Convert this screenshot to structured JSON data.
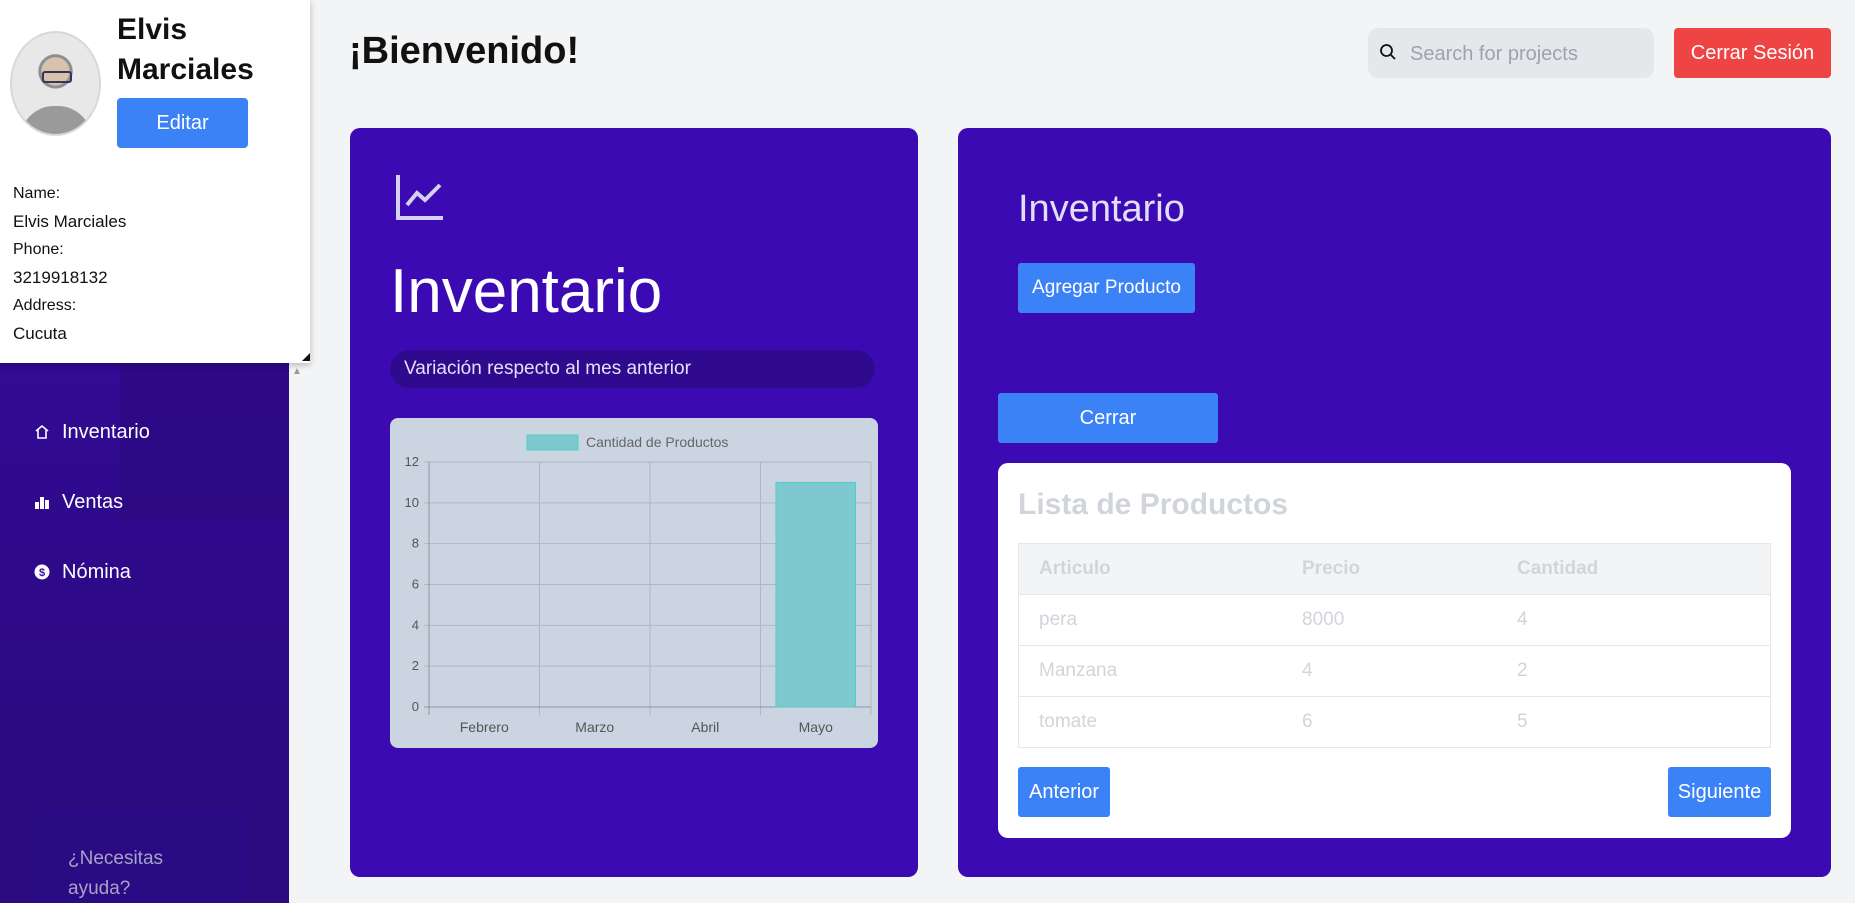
{
  "profile": {
    "name": "Elvis Marciales",
    "edit_label": "Editar",
    "name_label": "Name:",
    "name_value": "Elvis Marciales",
    "phone_label": "Phone:",
    "phone_value": "3219918132",
    "address_label": "Address:",
    "address_value": "Cucuta"
  },
  "sidebar": {
    "items": [
      {
        "label": "Inventario",
        "icon": "home-icon"
      },
      {
        "label": "Ventas",
        "icon": "bar-chart-icon"
      },
      {
        "label": "Nómina",
        "icon": "dollar-circle-icon"
      }
    ],
    "help_text": "¿Necesitas ayuda?"
  },
  "header": {
    "title": "¡Bienvenido!",
    "search_placeholder": "Search for projects",
    "logout_label": "Cerrar Sesión"
  },
  "stats_card": {
    "icon": "line-chart-icon",
    "title": "Inventario",
    "variation_text": "Variación respecto al mes anterior"
  },
  "chart_data": {
    "type": "bar",
    "categories": [
      "Febrero",
      "Marzo",
      "Abril",
      "Mayo"
    ],
    "series": [
      {
        "name": "Cantidad de Productos",
        "values": [
          0,
          0,
          0,
          11
        ]
      }
    ],
    "ylim": [
      0,
      12
    ],
    "yticks": [
      0,
      2,
      4,
      6,
      8,
      10,
      12
    ],
    "legend": "top-center",
    "grid": true,
    "colors": {
      "bar": "#7ec8cf",
      "bar_border": "#4fd1c5"
    }
  },
  "inventory_card": {
    "title": "Inventario",
    "add_label": "Agregar Producto",
    "close_label": "Cerrar",
    "list_title": "Lista de Productos",
    "columns": [
      "Articulo",
      "Precio",
      "Cantidad"
    ],
    "rows": [
      [
        "pera",
        "8000",
        "4"
      ],
      [
        "Manzana",
        "4",
        "2"
      ],
      [
        "tomate",
        "6",
        "5"
      ]
    ],
    "prev_label": "Anterior",
    "next_label": "Siguiente"
  },
  "colors": {
    "sidebar": "#3b0aa8",
    "card": "#3c0ab3",
    "primary": "#3b82f6",
    "danger": "#ef4444"
  }
}
